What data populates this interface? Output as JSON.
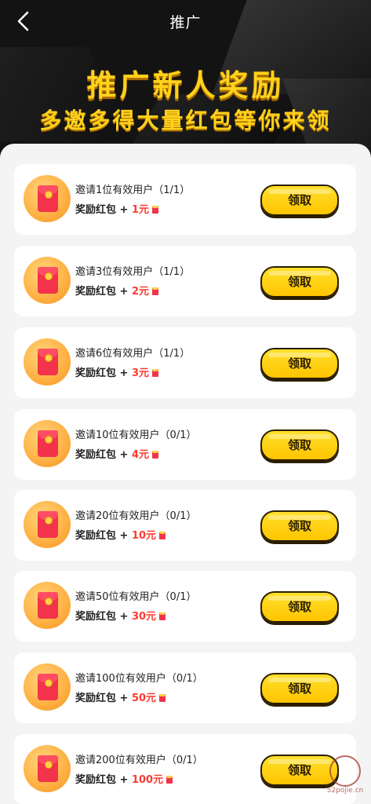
{
  "nav": {
    "title": "推广",
    "back_icon": "chevron-left-icon"
  },
  "banner": {
    "title": "推广新人奖励",
    "subtitle": "多邀多得大量红包等你来领"
  },
  "colors": {
    "accent_yellow": "#ffc400",
    "reward_red": "#ff3b30",
    "header_bg": "#131313"
  },
  "rewards": [
    {
      "title": "邀请1位有效用户（1/1）",
      "prefix": "奖励红包 + ",
      "amount": "1元",
      "button": "领取"
    },
    {
      "title": "邀请3位有效用户（1/1）",
      "prefix": "奖励红包 + ",
      "amount": "2元",
      "button": "领取"
    },
    {
      "title": "邀请6位有效用户（1/1）",
      "prefix": "奖励红包 + ",
      "amount": "3元",
      "button": "领取"
    },
    {
      "title": "邀请10位有效用户（0/1）",
      "prefix": "奖励红包 + ",
      "amount": "4元",
      "button": "领取"
    },
    {
      "title": "邀请20位有效用户（0/1）",
      "prefix": "奖励红包 + ",
      "amount": "10元",
      "button": "领取"
    },
    {
      "title": "邀请50位有效用户（0/1）",
      "prefix": "奖励红包 + ",
      "amount": "30元",
      "button": "领取"
    },
    {
      "title": "邀请100位有效用户（0/1）",
      "prefix": "奖励红包 + ",
      "amount": "50元",
      "button": "领取"
    },
    {
      "title": "邀请200位有效用户（0/1）",
      "prefix": "奖励红包 + ",
      "amount": "100元",
      "button": "领取"
    }
  ],
  "watermark": "52pojie.cn"
}
